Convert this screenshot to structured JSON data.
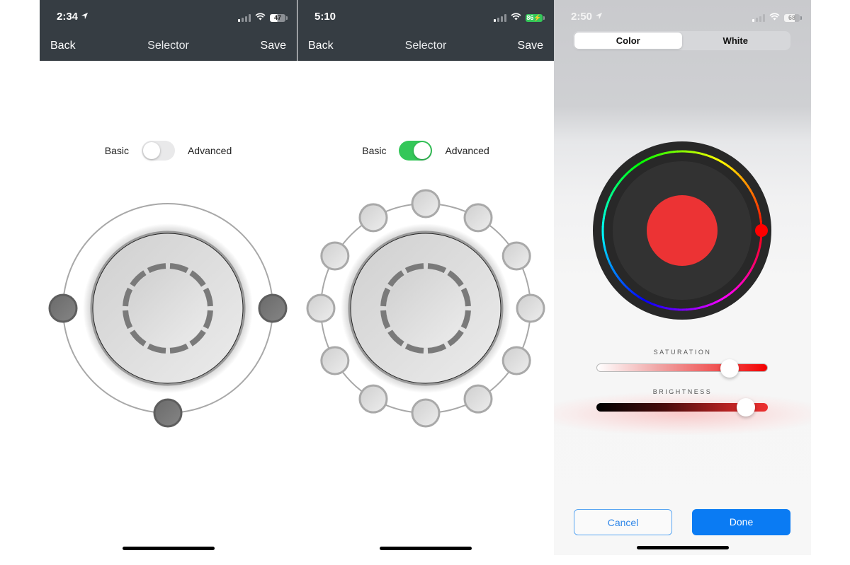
{
  "screens": [
    {
      "status": {
        "time": "2:34",
        "location_arrow": true,
        "signal_bars_on": 1,
        "battery": "47",
        "battery_charging": false
      },
      "nav": {
        "back": "Back",
        "title": "Selector",
        "save": "Save"
      },
      "mode": {
        "left_label": "Basic",
        "right_label": "Advanced",
        "advanced_enabled": false
      },
      "selector": {
        "outer_buttons": 3,
        "button_style": "dark"
      }
    },
    {
      "status": {
        "time": "5:10",
        "location_arrow": false,
        "signal_bars_on": 1,
        "battery": "86",
        "battery_charging": true
      },
      "nav": {
        "back": "Back",
        "title": "Selector",
        "save": "Save"
      },
      "mode": {
        "left_label": "Basic",
        "right_label": "Advanced",
        "advanced_enabled": true
      },
      "selector": {
        "outer_buttons": 12,
        "button_style": "light"
      }
    },
    {
      "status": {
        "time": "2:50",
        "location_arrow": true,
        "signal_bars_on": 1,
        "battery": "68",
        "battery_charging": false
      },
      "segments": [
        {
          "label": "Color",
          "active": true
        },
        {
          "label": "White",
          "active": false
        }
      ],
      "color_wheel": {
        "selected_color": "#ec3334",
        "hue_degrees": 0
      },
      "saturation": {
        "label": "SATURATION",
        "value": 0.78
      },
      "brightness": {
        "label": "BRIGHTNESS",
        "value": 0.87
      },
      "buttons": {
        "cancel": "Cancel",
        "done": "Done"
      }
    }
  ],
  "colors": {
    "navbar": "#363d43",
    "toggle_on": "#34c759",
    "accent_blue": "#0a7bf3",
    "battery_charging": "#34c759"
  }
}
